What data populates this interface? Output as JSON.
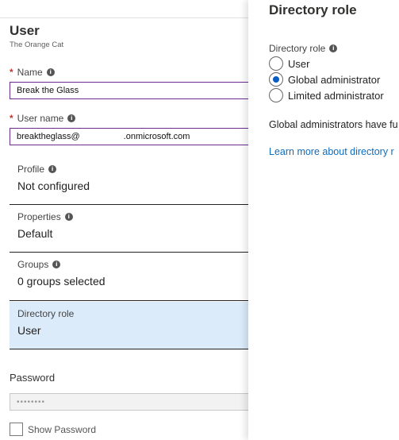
{
  "user_panel": {
    "title": "User",
    "subtitle": "The Orange Cat",
    "name_label": "Name",
    "name_value": "Break the Glass",
    "username_label": "User name",
    "username_value": "breaktheglass@                  .onmicrosoft.com",
    "sections": [
      {
        "label": "Profile",
        "value": "Not configured"
      },
      {
        "label": "Properties",
        "value": "Default"
      },
      {
        "label": "Groups",
        "value": "0 groups selected"
      },
      {
        "label": "Directory role",
        "value": "User"
      }
    ],
    "password_label": "Password",
    "password_value": "••••••••",
    "show_password_label": "Show Password"
  },
  "directory_role_panel": {
    "title": "Directory role",
    "field_label": "Directory role",
    "options": [
      "User",
      "Global administrator",
      "Limited administrator"
    ],
    "selected_option": "Global administrator",
    "description": "Global administrators have fu",
    "learn_more": "Learn more about directory r"
  },
  "colors": {
    "accent": "#0a5dc2",
    "field_border": "#6b2c91",
    "active_section": "#dcebfa",
    "link": "#0f6cbd"
  }
}
